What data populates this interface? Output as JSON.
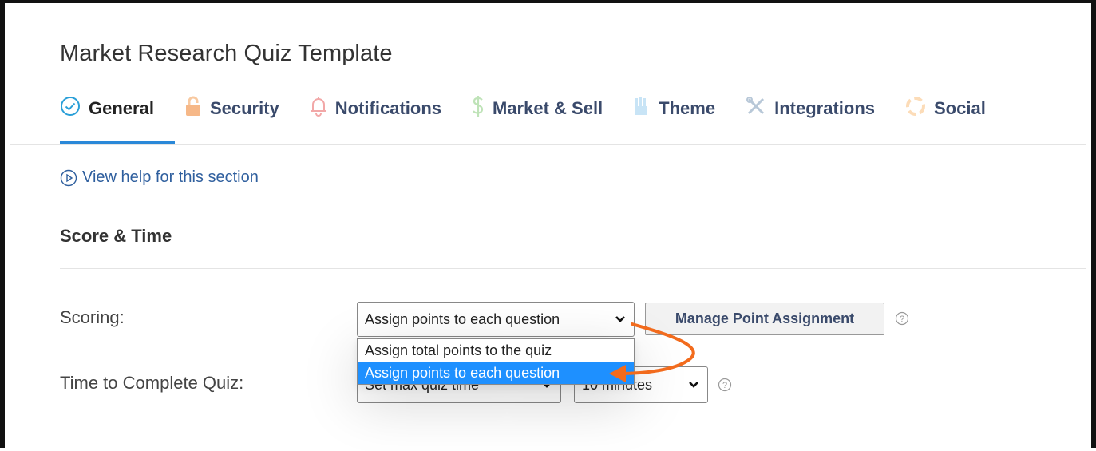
{
  "page_title": "Market Research Quiz Template",
  "tabs": [
    {
      "label": "General",
      "icon": "check-circle-icon",
      "active": true
    },
    {
      "label": "Security",
      "icon": "lock-icon",
      "active": false
    },
    {
      "label": "Notifications",
      "icon": "bell-icon",
      "active": false
    },
    {
      "label": "Market & Sell",
      "icon": "dollar-icon",
      "active": false
    },
    {
      "label": "Theme",
      "icon": "brush-icon",
      "active": false
    },
    {
      "label": "Integrations",
      "icon": "tools-icon",
      "active": false
    },
    {
      "label": "Social",
      "icon": "share-icon",
      "active": false
    }
  ],
  "help_link": "View help for this section",
  "section_heading": "Score & Time",
  "scoring": {
    "label": "Scoring:",
    "selected": "Assign points to each question",
    "options": [
      "Assign total points to the quiz",
      "Assign points to each question"
    ],
    "manage_button": "Manage Point Assignment"
  },
  "time": {
    "label": "Time to Complete Quiz:",
    "mode_value": "Set max quiz time",
    "duration_value": "10 minutes"
  },
  "colors": {
    "accent": "#2a88d8",
    "selected_option": "#1e90ff",
    "annotation_arrow": "#f26b1d"
  }
}
